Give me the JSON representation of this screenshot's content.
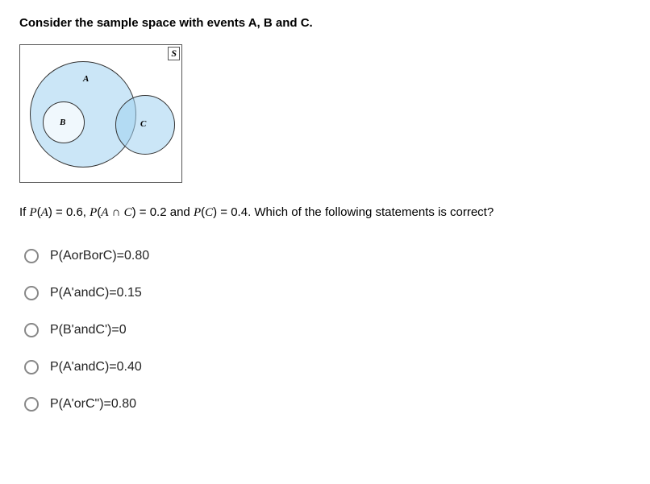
{
  "question": {
    "title": "Consider the sample space with events A, B and C.",
    "given_html": "If  <span class='math-var'>P</span>(<span class='math-var'>A</span>) = 0.6, <span class='math-var'>P</span>(<span class='math-var'>A</span> ∩ <span class='math-var'>C</span>) = 0.2 and <span class='math-var'>P</span>(<span class='math-var'>C</span>) = 0.4. Which of the following statements is correct?"
  },
  "venn": {
    "sample_space_label": "S",
    "label_a": "A",
    "label_b": "B",
    "label_c": "C"
  },
  "options": [
    {
      "label": "P(AorBorC)=0.80"
    },
    {
      "label": "P(A'andC)=0.15"
    },
    {
      "label": "P(B'andC')=0"
    },
    {
      "label": "P(A'andC)=0.40"
    },
    {
      "label": "P(A'orC\")=0.80"
    }
  ]
}
